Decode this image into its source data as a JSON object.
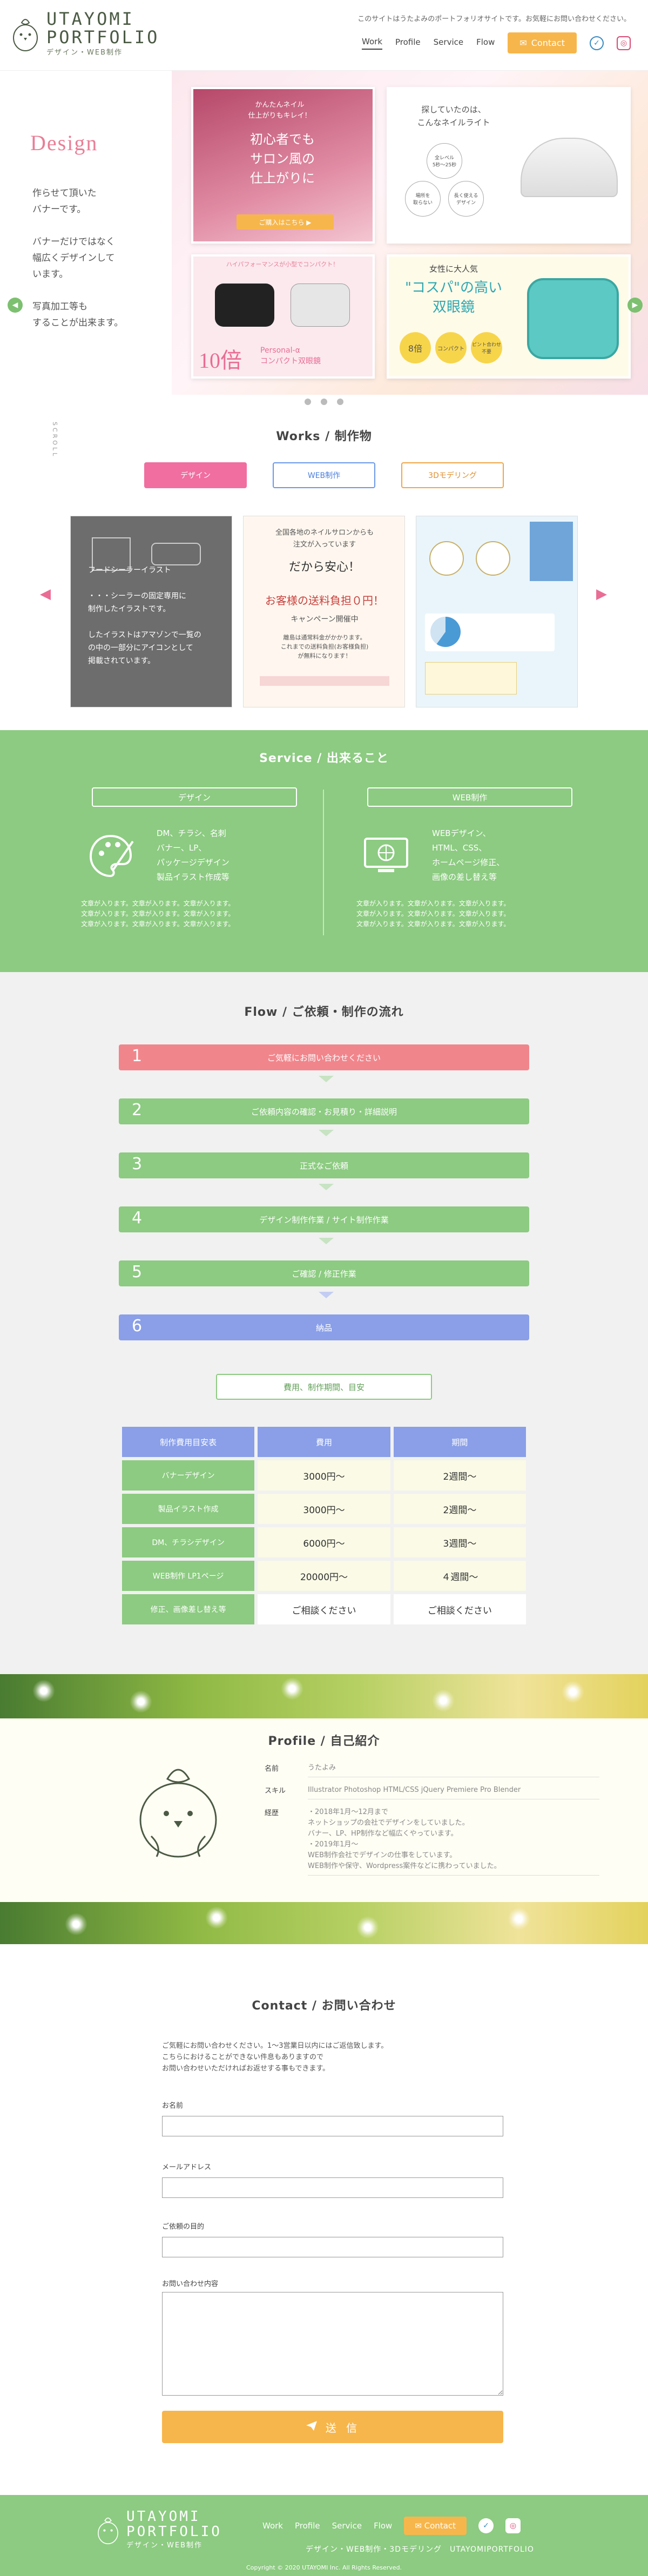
{
  "header": {
    "logo_title_1": "UTAYOMI",
    "logo_title_2": "PORTFOLIO",
    "logo_sub": "デザイン・WEB制作",
    "note": "このサイトはうたよみのポートフォリオサイトです。お気軽にお問い合わせください。",
    "nav": [
      "Work",
      "Profile",
      "Service",
      "Flow"
    ],
    "contact_label": "Contact"
  },
  "hero": {
    "heading": "Design",
    "text": "作らせて頂いた\nバナーです。\n\nバナーだけではなく\n幅広くデザインして\nいます。\n\n写真加工等も\nすることが出来ます。",
    "scroll": "SCROLL",
    "banner1": {
      "top": "かんたんネイル\n仕上がりもキレイ！",
      "main": "初心者でも\nサロン風の\n仕上がりに",
      "cta": "ご購入はこちら ▶"
    },
    "banner2": {
      "top": "探していたのは、\nこんなネイルライト",
      "c1": "全レベル\n5秒〜25秒",
      "c2": "場所を\n取らない",
      "c3": "長く使える\nデザイン"
    },
    "banner3": {
      "top": "ハイパフォーマンスが小型でコンパクト！",
      "big": "10倍",
      "sub": "Personal-α\nコンパクト双眼鏡"
    },
    "banner4": {
      "top": "女性に大人気",
      "main": "\"コスパ\"の高い\n双眼鏡",
      "b1": "8倍",
      "b2": "コンパクト",
      "b3": "ピント合わせ\n不要"
    }
  },
  "works": {
    "title": "Works / 制作物",
    "tabs": [
      "デザイン",
      "WEB制作",
      "3Dモデリング"
    ],
    "card1_overlay": "フードシーラーイラスト\n\n・・・シーラーの固定専用に\n制作したイラストです。\n\nしたイラストはアマゾンで一覧の\nの中の一部分にアイコンとして\n掲載されています。",
    "card2": {
      "t1": "全国各地のネイルサロンからも\n注文が入っています",
      "t2": "だから安心！",
      "t3": "お客様の送料負担０円！",
      "t4": "キャンペーン開催中",
      "t5": "離島は通常料金がかかります。\nこれまでの送料負担(お客様負担)\nが無料になります！"
    }
  },
  "service": {
    "title": "Service / 出来ること",
    "design_head": "デザイン",
    "design_list": [
      "DM、チラシ、名刺",
      "バナー、LP、",
      "パッケージデザイン",
      "製品イラスト作成等"
    ],
    "web_head": "WEB制作",
    "web_list": [
      "WEBデザイン、",
      "HTML、CSS、",
      "ホームページ修正、",
      "画像の差し替え等"
    ],
    "desc": "文章が入ります。文章が入ります。文章が入ります。\n文章が入ります。文章が入ります。文章が入ります。\n文章が入ります。文章が入ります。文章が入ります。"
  },
  "flow": {
    "title": "Flow / ご依頼・制作の流れ",
    "steps": [
      {
        "num": "1",
        "label": "ご気軽にお問い合わせください"
      },
      {
        "num": "2",
        "label": "ご依頼内容の確認・お見積り・詳細説明"
      },
      {
        "num": "3",
        "label": "正式なご依頼"
      },
      {
        "num": "4",
        "label": "デザイン制作作業 / サイト制作作業"
      },
      {
        "num": "5",
        "label": "ご確認 / 修正作業"
      },
      {
        "num": "6",
        "label": "納品"
      }
    ],
    "fee_label": "費用、制作期間、目安",
    "table_headers": [
      "制作費用目安表",
      "費用",
      "期間"
    ],
    "table_rows": [
      {
        "item": "バナーデザイン",
        "cost": "3000円〜",
        "period": "2週間〜"
      },
      {
        "item": "製品イラスト作成",
        "cost": "3000円〜",
        "period": "2週間〜"
      },
      {
        "item": "DM、チラシデザイン",
        "cost": "6000円〜",
        "period": "3週間〜"
      },
      {
        "item": "WEB制作 LP1ページ",
        "cost": "20000円〜",
        "period": "４週間〜"
      },
      {
        "item": "修正、画像差し替え等",
        "cost": "ご相談ください",
        "period": "ご相談ください"
      }
    ]
  },
  "profile": {
    "title": "Profile / 自己紹介",
    "rows": [
      {
        "k": "名前",
        "v": "うたよみ"
      },
      {
        "k": "スキル",
        "v": "Illustrator Photoshop HTML/CSS jQuery Premiere Pro Blender"
      },
      {
        "k": "経歴",
        "v": "・2018年1月〜12月まで\nネットショップの会社でデザインをしていました。\nバナー、LP、HP制作など幅広くやっています。\n・2019年1月〜\nWEB制作会社でデザインの仕事をしています。\nWEB制作や保守、Wordpress案件などに携わっていました。"
      }
    ]
  },
  "contact": {
    "title": "Contact / お問い合わせ",
    "intro": "ご気軽にお問い合わせください。1〜3営業日以内にはご返信致します。\nこちらにおけることができない件息もありますので\nお問い合わせいただければお返せする事もできます。",
    "fields": [
      "お名前",
      "メールアドレス",
      "ご依頼の目的",
      "お問い合わせ内容"
    ],
    "submit": "送 信"
  },
  "footer": {
    "logo_title_1": "UTAYOMI",
    "logo_title_2": "PORTFOLIO",
    "logo_sub": "デザイン・WEB制作",
    "nav": [
      "Work",
      "Profile",
      "Service",
      "Flow"
    ],
    "contact_label": "Contact",
    "links": "デザイン・WEB制作・3Dモデリング　UTAYOMIPORTFOLIO",
    "copyright": "Copyright © 2020 UTAYOMI Inc. All Rights Reserved."
  },
  "colors": {
    "green": "#8ccb81",
    "pink": "#f06ea0",
    "orange": "#f7b64b",
    "blue": "#8a9fe8",
    "salmon": "#f0868c"
  },
  "icons": [
    "logo-bird-icon",
    "mail-icon",
    "twitter-icon",
    "instagram-icon",
    "palette-icon",
    "monitor-icon",
    "paper-plane-icon"
  ]
}
